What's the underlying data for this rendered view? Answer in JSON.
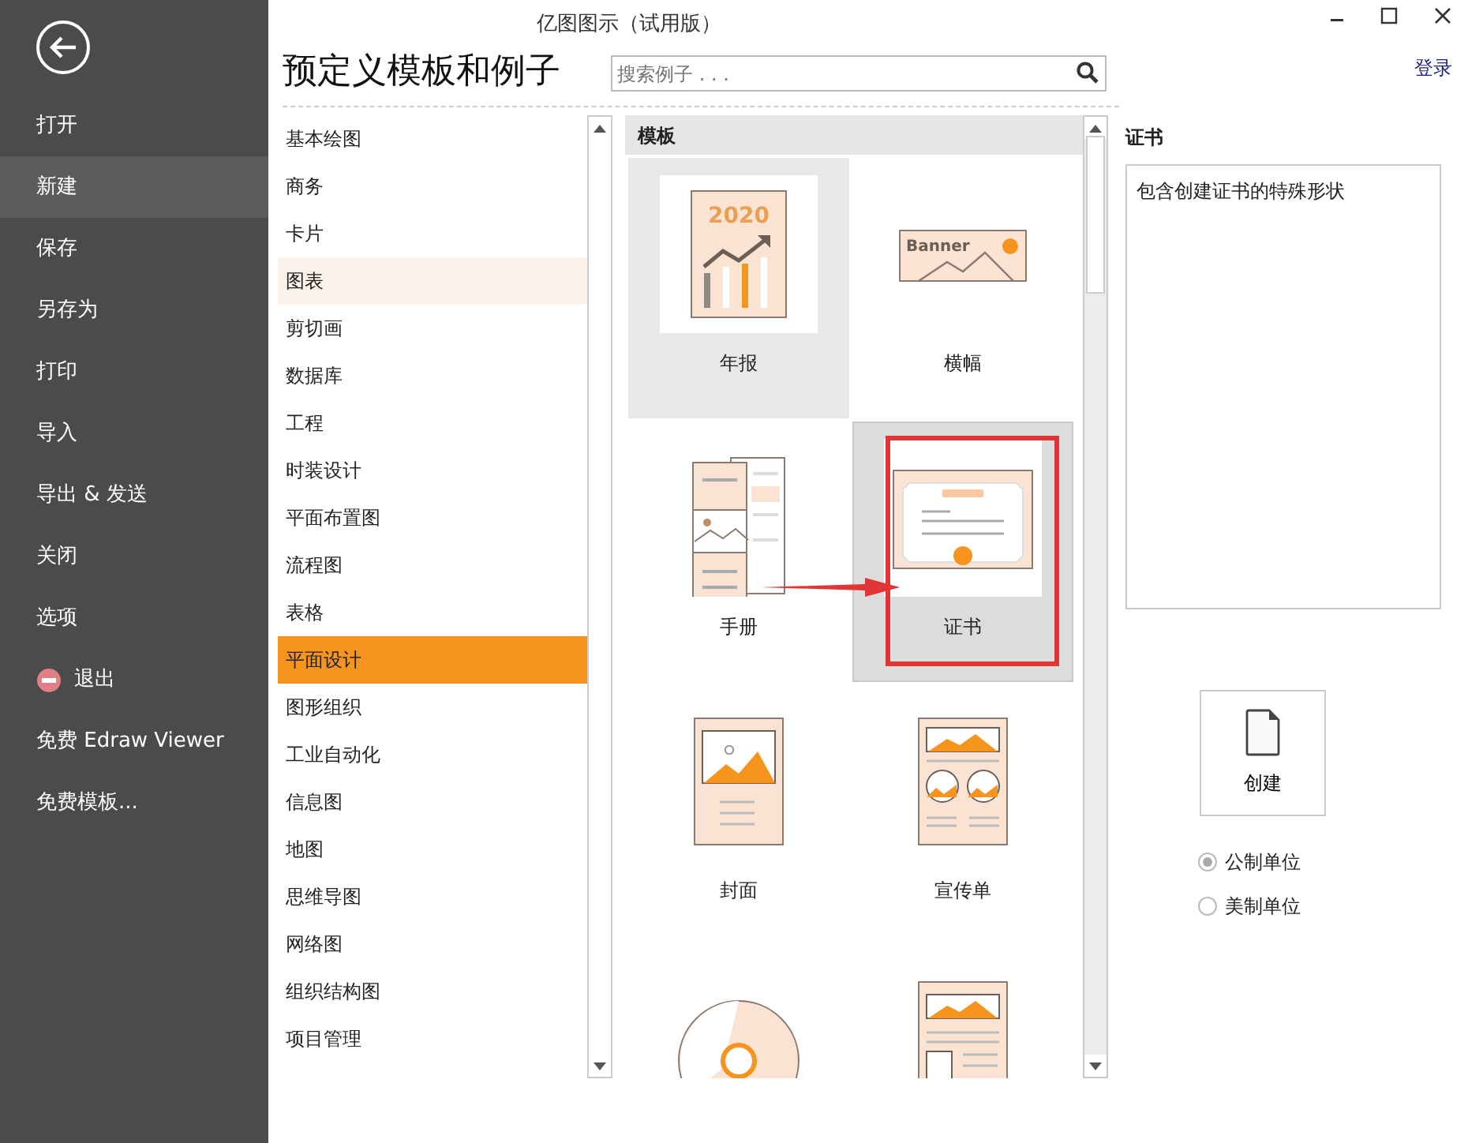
{
  "window": {
    "title": "亿图图示（试用版）",
    "login": "登录"
  },
  "sidebar": {
    "items": [
      {
        "label": "打开",
        "kind": "plain",
        "selected": false
      },
      {
        "label": "新建",
        "kind": "plain",
        "selected": true
      },
      {
        "label": "保存",
        "kind": "plain",
        "selected": false
      },
      {
        "label": "另存为",
        "kind": "plain",
        "selected": false
      },
      {
        "label": "打印",
        "kind": "plain",
        "selected": false
      },
      {
        "label": "导入",
        "kind": "plain",
        "selected": false
      },
      {
        "label": "导出 & 发送",
        "kind": "plain",
        "selected": false
      },
      {
        "label": "关闭",
        "kind": "plain",
        "selected": false
      },
      {
        "label": "选项",
        "kind": "plain",
        "selected": false
      },
      {
        "label": "退出",
        "kind": "exit",
        "selected": false
      },
      {
        "label": "免费 Edraw Viewer",
        "kind": "plain",
        "selected": false
      },
      {
        "label": "免费模板...",
        "kind": "plain",
        "selected": false
      }
    ]
  },
  "heading": "预定义模板和例子",
  "search": {
    "placeholder": "搜索例子 . . ."
  },
  "categories": [
    {
      "label": "基本绘图",
      "selected": false,
      "hovered": false
    },
    {
      "label": "商务",
      "selected": false,
      "hovered": false
    },
    {
      "label": "卡片",
      "selected": false,
      "hovered": false
    },
    {
      "label": "图表",
      "selected": false,
      "hovered": true
    },
    {
      "label": "剪切画",
      "selected": false,
      "hovered": false
    },
    {
      "label": "数据库",
      "selected": false,
      "hovered": false
    },
    {
      "label": "工程",
      "selected": false,
      "hovered": false
    },
    {
      "label": "时装设计",
      "selected": false,
      "hovered": false
    },
    {
      "label": "平面布置图",
      "selected": false,
      "hovered": false
    },
    {
      "label": "流程图",
      "selected": false,
      "hovered": false
    },
    {
      "label": "表格",
      "selected": false,
      "hovered": false
    },
    {
      "label": "平面设计",
      "selected": true,
      "hovered": false
    },
    {
      "label": "图形组织",
      "selected": false,
      "hovered": false
    },
    {
      "label": "工业自动化",
      "selected": false,
      "hovered": false
    },
    {
      "label": "信息图",
      "selected": false,
      "hovered": false
    },
    {
      "label": "地图",
      "selected": false,
      "hovered": false
    },
    {
      "label": "思维导图",
      "selected": false,
      "hovered": false
    },
    {
      "label": "网络图",
      "selected": false,
      "hovered": false
    },
    {
      "label": "组织结构图",
      "selected": false,
      "hovered": false
    },
    {
      "label": "项目管理",
      "selected": false,
      "hovered": false
    }
  ],
  "templates": {
    "header": "模板",
    "items": [
      {
        "label": "年报",
        "kind": "annual-report",
        "art_text": "2020",
        "selected": false,
        "hovered": true,
        "highlighted": false
      },
      {
        "label": "横幅",
        "kind": "banner",
        "art_text": "Banner",
        "selected": false,
        "hovered": false,
        "highlighted": false
      },
      {
        "label": "手册",
        "kind": "brochure",
        "selected": false,
        "hovered": false,
        "highlighted": false
      },
      {
        "label": "证书",
        "kind": "certificate",
        "selected": true,
        "hovered": false,
        "highlighted": true
      },
      {
        "label": "封面",
        "kind": "cover",
        "selected": false,
        "hovered": false,
        "highlighted": false
      },
      {
        "label": "宣传单",
        "kind": "flyer",
        "selected": false,
        "hovered": false,
        "highlighted": false
      },
      {
        "kind": "disc",
        "selected": false,
        "hovered": false,
        "highlighted": false
      },
      {
        "kind": "newsletter",
        "selected": false,
        "hovered": false,
        "highlighted": false
      }
    ]
  },
  "details": {
    "title": "证书",
    "description": "包含创建证书的特殊形状",
    "create_button": "创建",
    "units": [
      {
        "label": "公制单位",
        "selected": true
      },
      {
        "label": "美制单位",
        "selected": false
      }
    ]
  }
}
